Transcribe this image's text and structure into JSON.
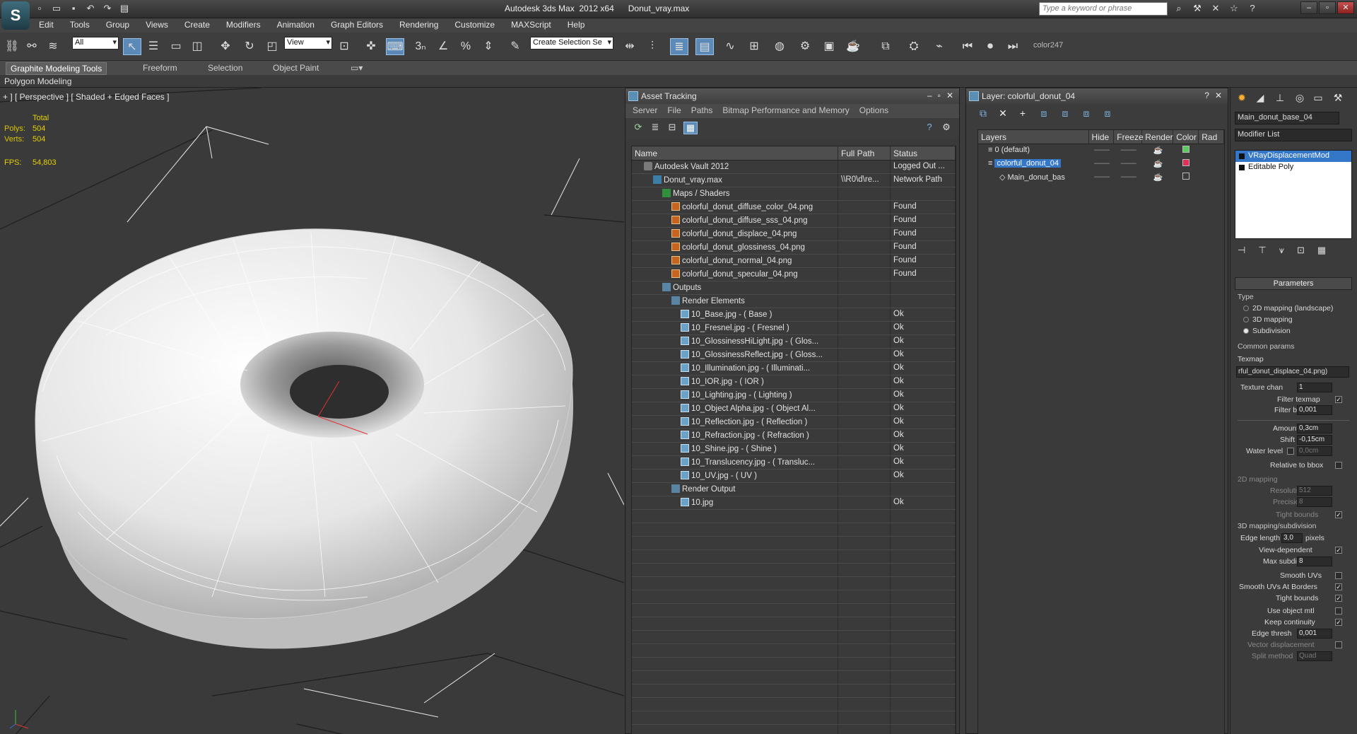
{
  "titlebar": {
    "title": "Autodesk 3ds Max  2012 x64      Donut_vray.max",
    "search_placeholder": "Type a keyword or phrase"
  },
  "menu": [
    "Edit",
    "Tools",
    "Group",
    "Views",
    "Create",
    "Modifiers",
    "Animation",
    "Graph Editors",
    "Rendering",
    "Customize",
    "MAXScript",
    "Help"
  ],
  "toolbar": {
    "filter_select": "All",
    "refcoord_select": "View",
    "selection_set": "Create Selection Se",
    "color_label": "color247"
  },
  "ribbon": {
    "tabs": [
      "Graphite Modeling Tools",
      "Freeform",
      "Selection",
      "Object Paint"
    ],
    "sub_label": "Polygon Modeling"
  },
  "viewport": {
    "label": "+ ] [ Perspective ] [ Shaded + Edged Faces ]",
    "stats_header": "Total",
    "polys_label": "Polys:",
    "polys_value": "504",
    "verts_label": "Verts:",
    "verts_value": "504",
    "fps_label": "FPS:",
    "fps_value": "54,803"
  },
  "asset_tracking": {
    "title": "Asset Tracking",
    "menu": [
      "Server",
      "File",
      "Paths",
      "Bitmap Performance and Memory",
      "Options"
    ],
    "columns": [
      "Name",
      "Full Path",
      "Status"
    ],
    "rows": [
      {
        "indent": 1,
        "icon": "vault",
        "name": "Autodesk Vault 2012",
        "path": "",
        "status": "Logged Out ..."
      },
      {
        "indent": 2,
        "icon": "max",
        "name": "Donut_vray.max",
        "path": "\\\\R0\\d\\re...",
        "status": "Network Path"
      },
      {
        "indent": 3,
        "icon": "map",
        "name": "Maps / Shaders",
        "path": "",
        "status": ""
      },
      {
        "indent": 4,
        "icon": "png",
        "name": "colorful_donut_diffuse_color_04.png",
        "path": "",
        "status": "Found"
      },
      {
        "indent": 4,
        "icon": "png",
        "name": "colorful_donut_diffuse_sss_04.png",
        "path": "",
        "status": "Found"
      },
      {
        "indent": 4,
        "icon": "png",
        "name": "colorful_donut_displace_04.png",
        "path": "",
        "status": "Found"
      },
      {
        "indent": 4,
        "icon": "png",
        "name": "colorful_donut_glossiness_04.png",
        "path": "",
        "status": "Found"
      },
      {
        "indent": 4,
        "icon": "png",
        "name": "colorful_donut_normal_04.png",
        "path": "",
        "status": "Found"
      },
      {
        "indent": 4,
        "icon": "png",
        "name": "colorful_donut_specular_04.png",
        "path": "",
        "status": "Found"
      },
      {
        "indent": 3,
        "icon": "out",
        "name": "Outputs",
        "path": "",
        "status": ""
      },
      {
        "indent": 4,
        "icon": "out",
        "name": "Render Elements",
        "path": "",
        "status": ""
      },
      {
        "indent": 5,
        "icon": "jpg",
        "name": "10_Base.jpg - ( Base )",
        "path": "",
        "status": "Ok"
      },
      {
        "indent": 5,
        "icon": "jpg",
        "name": "10_Fresnel.jpg - ( Fresnel )",
        "path": "",
        "status": "Ok"
      },
      {
        "indent": 5,
        "icon": "jpg",
        "name": "10_GlossinessHiLight.jpg - ( Glos...",
        "path": "",
        "status": "Ok"
      },
      {
        "indent": 5,
        "icon": "jpg",
        "name": "10_GlossinessReflect.jpg - ( Gloss...",
        "path": "",
        "status": "Ok"
      },
      {
        "indent": 5,
        "icon": "jpg",
        "name": "10_Illumination.jpg - ( Illuminati...",
        "path": "",
        "status": "Ok"
      },
      {
        "indent": 5,
        "icon": "jpg",
        "name": "10_IOR.jpg - ( IOR )",
        "path": "",
        "status": "Ok"
      },
      {
        "indent": 5,
        "icon": "jpg",
        "name": "10_Lighting.jpg - ( Lighting )",
        "path": "",
        "status": "Ok"
      },
      {
        "indent": 5,
        "icon": "jpg",
        "name": "10_Object Alpha.jpg - ( Object Al...",
        "path": "",
        "status": "Ok"
      },
      {
        "indent": 5,
        "icon": "jpg",
        "name": "10_Reflection.jpg - ( Reflection )",
        "path": "",
        "status": "Ok"
      },
      {
        "indent": 5,
        "icon": "jpg",
        "name": "10_Refraction.jpg - ( Refraction )",
        "path": "",
        "status": "Ok"
      },
      {
        "indent": 5,
        "icon": "jpg",
        "name": "10_Shine.jpg - ( Shine )",
        "path": "",
        "status": "Ok"
      },
      {
        "indent": 5,
        "icon": "jpg",
        "name": "10_Translucency.jpg - ( Transluc...",
        "path": "",
        "status": "Ok"
      },
      {
        "indent": 5,
        "icon": "jpg",
        "name": "10_UV.jpg - ( UV )",
        "path": "",
        "status": "Ok"
      },
      {
        "indent": 4,
        "icon": "out",
        "name": "Render Output",
        "path": "",
        "status": ""
      },
      {
        "indent": 5,
        "icon": "jpg",
        "name": "10.jpg",
        "path": "",
        "status": "Ok"
      }
    ]
  },
  "layer_window": {
    "title": "Layer: colorful_donut_04",
    "columns": [
      "Layers",
      "Hide",
      "Freeze",
      "Render",
      "Color",
      "Rad"
    ],
    "rows": [
      {
        "name": "0 (default)",
        "selected": false,
        "color": "#5cc860"
      },
      {
        "name": "colorful_donut_04",
        "selected": true,
        "color": "#e0305a"
      },
      {
        "name": "Main_donut_bas",
        "selected": false,
        "color": "#3a3a3a"
      }
    ]
  },
  "command_panel": {
    "object_name": "Main_donut_base_04",
    "modifier_list": "Modifier List",
    "stack": [
      "VRayDisplacementMod",
      "Editable Poly"
    ],
    "rollout_title": "Parameters",
    "type_group": "Type",
    "type_options": [
      "2D mapping (landscape)",
      "3D mapping",
      "Subdivision"
    ],
    "type_selected": 2,
    "common_group": "Common params",
    "texmap_label": "Texmap",
    "texmap_value": "rful_donut_displace_04.png)",
    "texture_chan_label": "Texture chan",
    "texture_chan_value": "1",
    "filter_texmap_label": "Filter texmap",
    "filter_blur_label": "Filter blur",
    "filter_blur_value": "0,001",
    "amount_label": "Amount",
    "amount_value": "0,3cm",
    "shift_label": "Shift",
    "shift_value": "-0,15cm",
    "water_level_label": "Water level",
    "water_level_value": "0,0cm",
    "relative_bbox_label": "Relative to bbox",
    "mapping2d_group": "2D mapping",
    "resolution_label": "Resolution",
    "resolution_value": "512",
    "precision_label": "Precision",
    "precision_value": "8",
    "tight_bounds_label": "Tight bounds",
    "sub_group": "3D mapping/subdivision",
    "edge_length_label": "Edge length",
    "edge_length_value": "3,0",
    "pixels_label": "pixels",
    "view_dependent_label": "View-dependent",
    "max_subdivs_label": "Max subdivs",
    "max_subdivs_value": "8",
    "smooth_uvs_label": "Smooth UVs",
    "smooth_uvs_borders_label": "Smooth UVs At Borders",
    "tight_bounds2_label": "Tight bounds",
    "use_object_mtl_label": "Use object mtl",
    "keep_continuity_label": "Keep continuity",
    "edge_thresh_label": "Edge thresh",
    "edge_thresh_value": "0,001",
    "vector_disp_label": "Vector displacement",
    "split_method_label": "Split method",
    "split_method_value": "Quad"
  }
}
